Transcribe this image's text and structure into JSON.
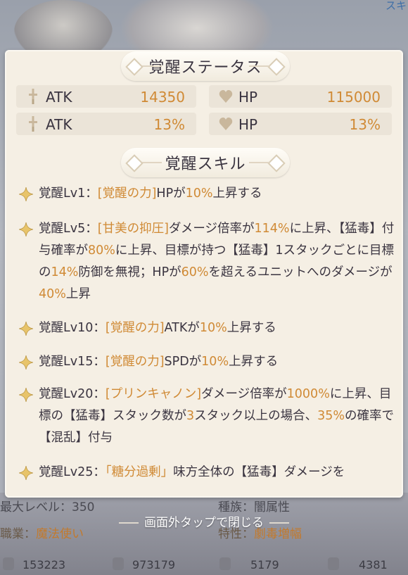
{
  "corner_text": "スキ",
  "panel": {
    "status_title": "覚醒ステータス",
    "stats": [
      {
        "icon": "sword-icon",
        "name": "ATK",
        "value": "14350"
      },
      {
        "icon": "heart-icon",
        "name": "HP",
        "value": "115000"
      },
      {
        "icon": "sword-icon",
        "name": "ATK",
        "value": "13%"
      },
      {
        "icon": "heart-icon",
        "name": "HP",
        "value": "13%"
      }
    ],
    "skill_title": "覚醒スキル",
    "skills": [
      {
        "lines": [
          [
            "覚醒Lv1：",
            ""
          ],
          [
            "[覚醒の力]",
            "o"
          ],
          [
            "HPが",
            ""
          ],
          [
            "10%",
            "o"
          ],
          [
            "上昇する",
            ""
          ]
        ]
      },
      {
        "lines": [
          [
            "覚醒Lv5：",
            ""
          ],
          [
            "[甘美の抑圧]",
            "o"
          ],
          [
            "ダメージ倍率が",
            ""
          ],
          [
            "114%",
            "o"
          ],
          [
            "に上昇、【猛毒】付与確率が",
            ""
          ],
          [
            "80%",
            "o"
          ],
          [
            "に上昇、目標が持つ【猛毒】1スタックごとに目標の",
            ""
          ],
          [
            "14%",
            "o"
          ],
          [
            "防御を無視；HPが",
            ""
          ],
          [
            "60%",
            "o"
          ],
          [
            "を超えるユニットへのダメージが",
            ""
          ],
          [
            "40%",
            "o"
          ],
          [
            "上昇",
            ""
          ]
        ]
      },
      {
        "lines": [
          [
            "覚醒Lv10：",
            ""
          ],
          [
            "[覚醒の力]",
            "o"
          ],
          [
            "ATKが",
            ""
          ],
          [
            "10%",
            "o"
          ],
          [
            "上昇する",
            ""
          ]
        ]
      },
      {
        "lines": [
          [
            "覚醒Lv15：",
            ""
          ],
          [
            "[覚醒の力]",
            "o"
          ],
          [
            "SPDが",
            ""
          ],
          [
            "10%",
            "o"
          ],
          [
            "上昇する",
            ""
          ]
        ]
      },
      {
        "lines": [
          [
            "覚醒Lv20：",
            ""
          ],
          [
            "[プリンキャノン]",
            "o"
          ],
          [
            "ダメージ倍率が",
            ""
          ],
          [
            "1000%",
            "o"
          ],
          [
            "に上昇、目標の【猛毒】スタック数が",
            ""
          ],
          [
            "3",
            "o"
          ],
          [
            "スタック以上の場合、",
            ""
          ],
          [
            "35%",
            "o"
          ],
          [
            "の確率で【混乱】付与",
            ""
          ]
        ]
      },
      {
        "lines": [
          [
            "覚醒Lv25：",
            ""
          ],
          [
            "「糖分過剰」",
            "o"
          ],
          [
            "味方全体の【猛毒】ダメージを",
            ""
          ]
        ]
      }
    ]
  },
  "background": {
    "max_level": "最大レベル：350",
    "race": "種族：闇属性",
    "job_label": "職業：",
    "job_value": "魔法使い",
    "trait_label": "特性：",
    "trait_value": "劇毒増幅",
    "stats": [
      "153223",
      "973179",
      "5179",
      "4381"
    ]
  },
  "close_hint": "画面外タップで閉じる",
  "colors": {
    "accent": "#d08a35",
    "panel": "#f5efe4",
    "stat_box": "#ebe4d8"
  }
}
